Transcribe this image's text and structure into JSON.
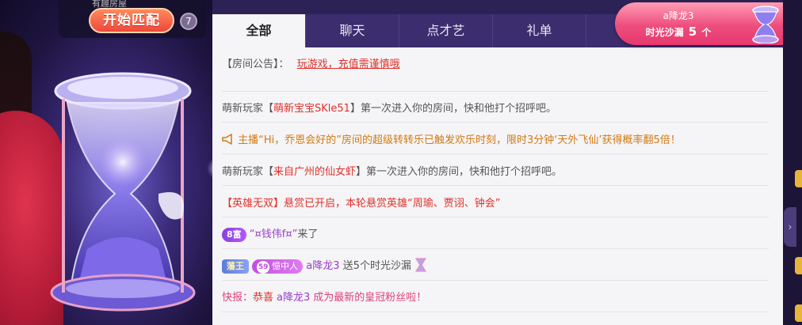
{
  "match": {
    "top_text": "有趣房屋",
    "button_label": "开始匹配",
    "count": "7"
  },
  "tabs": [
    {
      "label": "全部",
      "active": true
    },
    {
      "label": "聊天",
      "active": false
    },
    {
      "label": "点才艺",
      "active": false
    },
    {
      "label": "礼单",
      "active": false
    }
  ],
  "gift_notice": {
    "user": "a降龙3",
    "item": "时光沙漏",
    "count": "5",
    "unit": "个"
  },
  "announcement": {
    "label": "【房间公告】：",
    "text": "玩游戏，充值需谨慎哦"
  },
  "messages": [
    {
      "prefix": "萌新玩家【",
      "name": "萌新宝宝SKle51",
      "suffix": "】第一次进入你的房间，快和他打个招呼吧。"
    },
    {
      "text": "主播“Hi，乔恩会好的”房间的超级转转乐已触发欢乐时刻，限时3分钟‘天外飞仙’获得概率翻5倍！"
    },
    {
      "prefix": "萌新玩家【",
      "name": "来自广州的仙女虾",
      "suffix": "】第一次进入你的房间，快和他打个招呼吧。"
    },
    {
      "tag": "【英雄无双】",
      "text": "悬赏已开启，本轮悬赏英雄“周瑜、贾诩、钟会”"
    },
    {
      "badge": "8富",
      "name": "“¤钱伟f¤”",
      "suffix": "来了"
    },
    {
      "badge_king": "藩王",
      "fan_level": "59",
      "fan_name": "憶中人",
      "name": "a降龙3",
      "text": "送5个时光沙漏"
    },
    {
      "prefix": "快报：",
      "mid": "恭喜",
      "name": "a降龙3",
      "suffix": "成为最新的皇冠粉丝啦！"
    }
  ],
  "colors": {
    "accent_red": "#e0312a",
    "tab_bar": "#3b2d6e",
    "panel_bg": "#f5f4f6",
    "gift_pink": "#ee4d7e"
  }
}
